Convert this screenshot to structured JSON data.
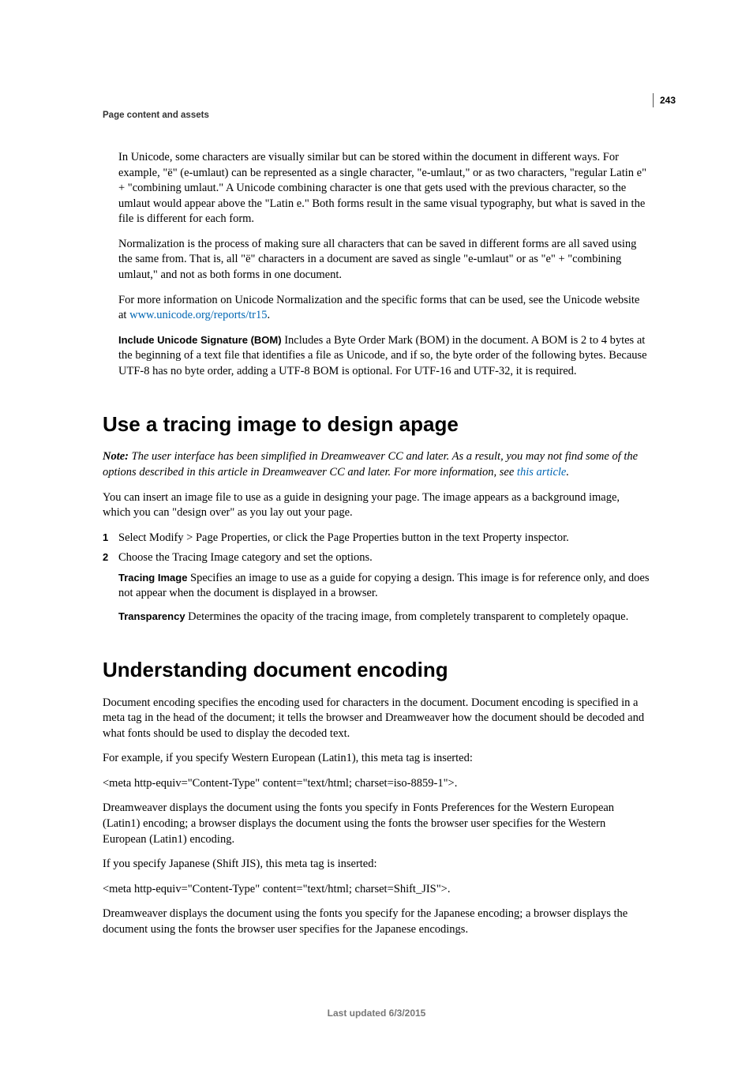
{
  "page_number": "243",
  "running_head": "Page content and assets",
  "intro": {
    "p1": "In Unicode, some characters are visually similar but can be stored within the document in different ways. For example, \"ë\" (e-umlaut) can be represented as a single character, \"e-umlaut,\" or as two characters, \"regular Latin e\" + \"combining umlaut.\" A Unicode combining character is one that gets used with the previous character, so the umlaut would appear above the \"Latin e.\" Both forms result in the same visual typography, but what is saved in the file is different for each form.",
    "p2": "Normalization is the process of making sure all characters that can be saved in different forms are all saved using the same from. That is, all \"ë\" characters in a document are saved as single \"e-umlaut\" or as \"e\" + \"combining umlaut,\" and not as both forms in one document.",
    "p3a": "For more information on Unicode Normalization and the specific forms that can be used, see the Unicode website at ",
    "p3link": "www.unicode.org/reports/tr15",
    "p3b": ".",
    "bom_label": "Include Unicode Signature (BOM)",
    "bom_text": "  Includes a Byte Order Mark (BOM) in the document. A BOM is 2 to 4 bytes at the beginning of a text file that identifies a file as Unicode, and if so, the byte order of the following bytes. Because UTF-8 has no byte order, adding a UTF-8 BOM is optional. For UTF-16 and UTF-32, it is required."
  },
  "section_tracing": {
    "heading": "Use a tracing image to design apage",
    "note_label": "Note: ",
    "note_text_a": "The user interface has been simplified in Dreamweaver CC and later. As a result, you may not find some of the options described in this article in Dreamweaver CC and later. For more information, see ",
    "note_link": "this article",
    "note_text_b": ".",
    "p1": "You can insert an image file to use as a guide in designing your page. The image appears as a background image, which you can \"design over\" as you lay out your page.",
    "step1_num": "1",
    "step1": "Select Modify > Page Properties, or click the Page Properties button in the text Property inspector.",
    "step2_num": "2",
    "step2": "Choose the Tracing Image category and set the options.",
    "def1_label": "Tracing Image",
    "def1_text": "  Specifies an image to use as a guide for copying a design. This image is for reference only, and does not appear when the document is displayed in a browser.",
    "def2_label": "Transparency",
    "def2_text": "  Determines the opacity of the tracing image, from completely transparent to completely opaque."
  },
  "section_encoding": {
    "heading": "Understanding document encoding",
    "p1": "Document encoding specifies the encoding used for characters in the document. Document encoding is specified in a meta tag in the head of the document; it tells the browser and Dreamweaver how the document should be decoded and what fonts should be used to display the decoded text.",
    "p2": "For example, if you specify Western European (Latin1), this meta tag is inserted:",
    "p3": "<meta http-equiv=\"Content-Type\" content=\"text/html; charset=iso-8859-1\">.",
    "p4": "Dreamweaver displays the document using the fonts you specify in Fonts Preferences for the Western European (Latin1) encoding; a browser displays the document using the fonts the browser user specifies for the Western European (Latin1) encoding.",
    "p5": "If you specify Japanese (Shift JIS), this meta tag is inserted:",
    "p6": "<meta http-equiv=\"Content-Type\" content=\"text/html; charset=Shift_JIS\">.",
    "p7": "Dreamweaver displays the document using the fonts you specify for the Japanese encoding; a browser displays the document using the fonts the browser user specifies for the Japanese encodings."
  },
  "footer": "Last updated 6/3/2015"
}
